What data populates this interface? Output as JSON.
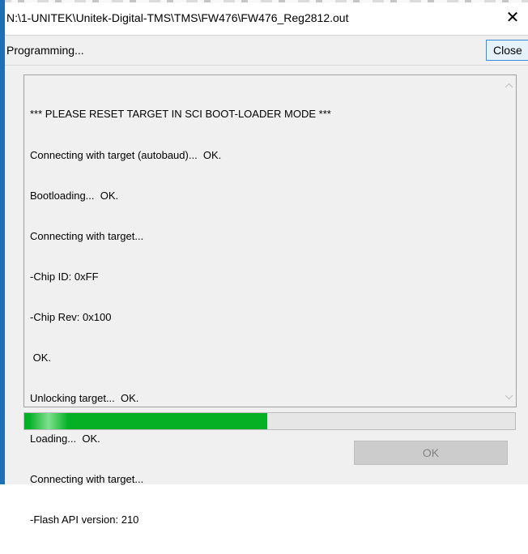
{
  "window": {
    "title": "N:\\1-UNITEK\\Unitek-Digital-TMS\\TMS\\FW476\\FW476_Reg2812.out",
    "close_glyph": "✕"
  },
  "toolbar": {
    "status": "Programming...",
    "close_label": "Close"
  },
  "log": {
    "lines": [
      "*** PLEASE RESET TARGET IN SCI BOOT-LOADER MODE ***",
      "Connecting with target (autobaud)...  OK.",
      "Bootloading...  OK.",
      "Connecting with target...",
      "-Chip ID: 0xFF",
      "-Chip Rev: 0x100",
      " OK.",
      "Unlocking target...  OK.",
      "Loading...  OK.",
      "Connecting with target...",
      "-Flash API version: 210"
    ]
  },
  "progress": {
    "fraction": 0.495
  },
  "footer": {
    "ok_label": "OK"
  },
  "icons": {
    "scroll_up": "chevron-up-icon",
    "scroll_down": "chevron-down-icon",
    "close": "close-icon"
  },
  "colors": {
    "progress_fill": "#06b025",
    "title_accent": "#1f6fb5"
  }
}
